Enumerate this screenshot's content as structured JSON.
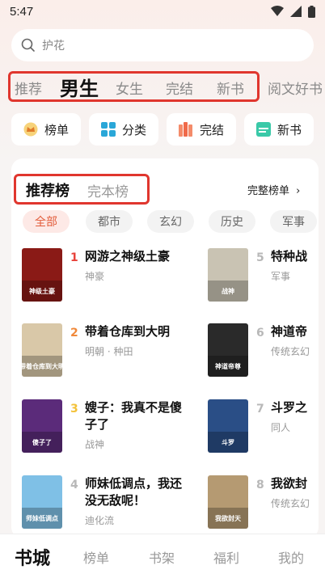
{
  "status": {
    "time": "5:47"
  },
  "search": {
    "placeholder": "护花"
  },
  "category_tabs": [
    {
      "label": "推荐"
    },
    {
      "label": "男生"
    },
    {
      "label": "女生"
    },
    {
      "label": "完结"
    },
    {
      "label": "新书"
    },
    {
      "label": "阅文好书"
    }
  ],
  "quick_links": [
    {
      "label": "榜单",
      "icon": "crown-icon"
    },
    {
      "label": "分类",
      "icon": "grid-icon"
    },
    {
      "label": "完结",
      "icon": "books-icon"
    },
    {
      "label": "新书",
      "icon": "new-book-icon"
    }
  ],
  "ranking": {
    "tab_active": "推荐榜",
    "tab_other": "完本榜",
    "full_list": "完整榜单",
    "genres": [
      "全部",
      "都市",
      "玄幻",
      "历史",
      "军事"
    ],
    "books": [
      {
        "rank": "1",
        "title": "网游之神级土豪",
        "sub": "神豪",
        "rank_color": "#e8423a",
        "cover_color": "#8a1a16",
        "cover_text": "神级土豪"
      },
      {
        "rank": "2",
        "title": "带着仓库到大明",
        "sub": "明朝 · 种田",
        "rank_color": "#f0893a",
        "cover_color": "#d9c8a8",
        "cover_text": "带着仓库到大明"
      },
      {
        "rank": "3",
        "title": "嫂子：我真不是傻子了",
        "sub": "战神",
        "rank_color": "#f3c23a",
        "cover_color": "#5b2b7a",
        "cover_text": "傻子了"
      },
      {
        "rank": "4",
        "title": "师妹低调点，我还没无敌呢！",
        "sub": "迪化流",
        "rank_color": "#b8b8b8",
        "cover_color": "#7fc0e6",
        "cover_text": "师妹低调点"
      },
      {
        "rank": "5",
        "title": "特种战",
        "sub": "军事",
        "rank_color": "#b8b8b8",
        "cover_color": "#c9c3b3",
        "cover_text": "战神"
      },
      {
        "rank": "6",
        "title": "神道帝",
        "sub": "传统玄幻",
        "rank_color": "#b8b8b8",
        "cover_color": "#2a2a2a",
        "cover_text": "神道帝尊"
      },
      {
        "rank": "7",
        "title": "斗罗之",
        "sub": "同人",
        "rank_color": "#b8b8b8",
        "cover_color": "#2a4e86",
        "cover_text": "斗罗"
      },
      {
        "rank": "8",
        "title": "我欲封",
        "sub": "传统玄幻",
        "rank_color": "#b8b8b8",
        "cover_color": "#b59a72",
        "cover_text": "我欲封天"
      }
    ]
  },
  "bottom_nav": [
    {
      "label": "书城"
    },
    {
      "label": "榜单"
    },
    {
      "label": "书架"
    },
    {
      "label": "福利"
    },
    {
      "label": "我的"
    }
  ],
  "colors": {
    "highlight_box": "#e0362e",
    "accent": "#e25c3a"
  }
}
